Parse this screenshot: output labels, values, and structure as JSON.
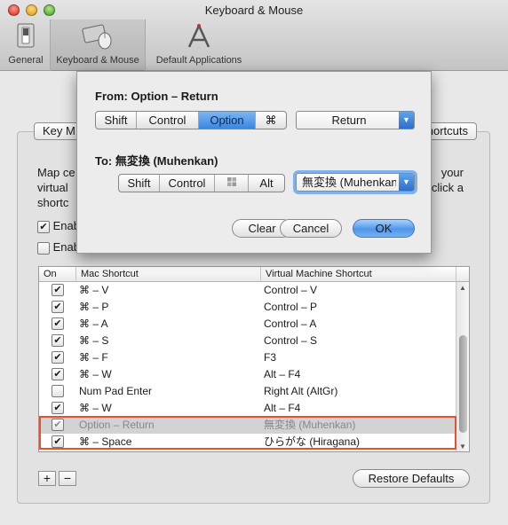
{
  "window": {
    "title": "Keyboard & Mouse",
    "toolbar": [
      {
        "label": "General",
        "icon": "switch-icon"
      },
      {
        "label": "Keyboard & Mouse",
        "icon": "keyboard-mouse-icon"
      },
      {
        "label": "Default Applications",
        "icon": "applications-icon"
      }
    ]
  },
  "tabs": {
    "left": "Key M",
    "right": "hortcuts"
  },
  "description": {
    "line1": "Map ce",
    "line1_right": "your",
    "line2": "virtual",
    "line2_right": "click a",
    "line3": "shortc"
  },
  "checkboxes": {
    "enable_key_mappings": {
      "label": "Enab",
      "checked": true
    },
    "enable_language_mappings": {
      "label": "Enab",
      "checked": false
    }
  },
  "table": {
    "headers": [
      "On",
      "Mac Shortcut",
      "Virtual Machine Shortcut"
    ],
    "rows": [
      {
        "on": true,
        "mac": "⌘ – V",
        "vm": "Control – V"
      },
      {
        "on": true,
        "mac": "⌘ – P",
        "vm": "Control – P"
      },
      {
        "on": true,
        "mac": "⌘ – A",
        "vm": "Control – A"
      },
      {
        "on": true,
        "mac": "⌘ – S",
        "vm": "Control – S"
      },
      {
        "on": true,
        "mac": "⌘ – F",
        "vm": "F3"
      },
      {
        "on": true,
        "mac": "⌘ – W",
        "vm": "Alt – F4"
      },
      {
        "on": false,
        "mac": "Num Pad Enter",
        "vm": "Right Alt (AltGr)"
      },
      {
        "on": true,
        "mac": "⌘ – W",
        "vm": "Alt – F4"
      },
      {
        "on": true,
        "mac": "Option – Return",
        "vm": "無変換 (Muhenkan)"
      },
      {
        "on": true,
        "mac": "⌘ – Space",
        "vm": "ひらがな (Hiragana)"
      }
    ]
  },
  "bottom": {
    "add": "+",
    "remove": "−",
    "restore": "Restore Defaults"
  },
  "sheet": {
    "from_label": "From: Option – Return",
    "from_modifiers": [
      "Shift",
      "Control",
      "Option",
      "⌘"
    ],
    "from_active": "Option",
    "from_key": "Return",
    "to_label": "To: 無変換 (Muhenkan)",
    "to_modifiers": [
      "Shift",
      "Control",
      "",
      "Alt"
    ],
    "to_key": "無変換 (Muhenkan)",
    "clear": "Clear",
    "cancel": "Cancel",
    "ok": "OK"
  },
  "colors": {
    "accent": "#3c86df",
    "highlight_border": "#e4522f"
  }
}
